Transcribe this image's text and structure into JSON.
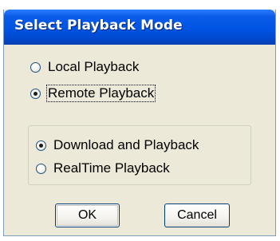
{
  "dialog": {
    "title": "Select Playback Mode",
    "mode_options": [
      {
        "label": "Local Playback",
        "checked": false
      },
      {
        "label": "Remote Playback",
        "checked": true
      }
    ],
    "remote_options": [
      {
        "label": "Download and Playback",
        "checked": true
      },
      {
        "label": "RealTime Playback",
        "checked": false
      }
    ],
    "buttons": {
      "ok_label": "OK",
      "cancel_label": "Cancel"
    }
  },
  "colors": {
    "titlebar": "#0054e3",
    "dialog_background": "#ece9d8",
    "button_border": "#003c74"
  }
}
